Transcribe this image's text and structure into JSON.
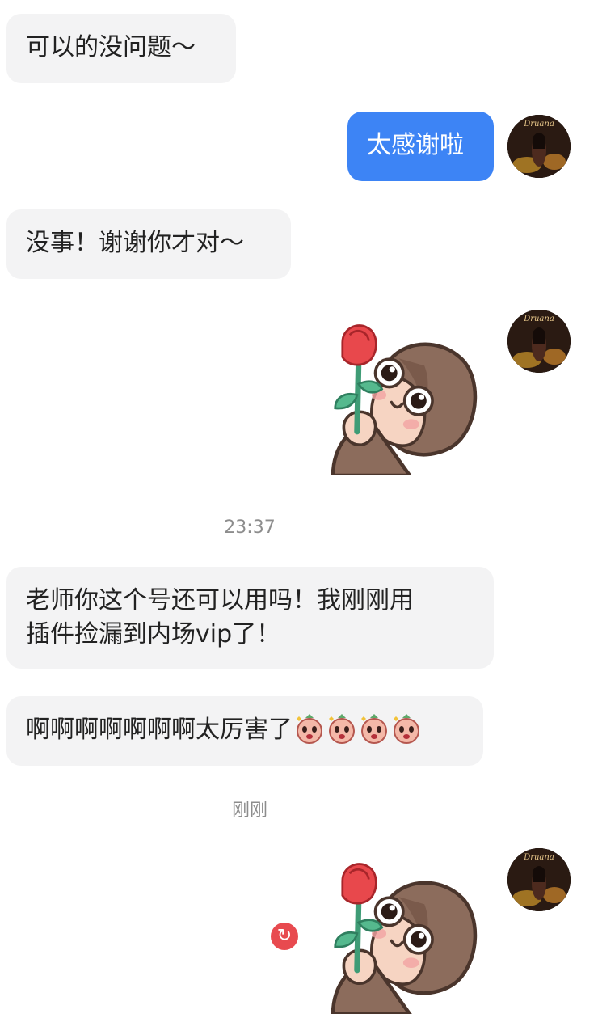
{
  "messages": {
    "m1": "可以的没问题～",
    "m2": "太感谢啦",
    "m3": "没事！谢谢你才对～",
    "m5_line1": "老师你这个号还可以用吗！我刚刚用",
    "m5_line2": "插件捡漏到内场vip了！",
    "m6": "啊啊啊啊啊啊啊太厉害了"
  },
  "timestamps": {
    "t1": "23:37",
    "t2": "刚刚"
  },
  "avatar": {
    "label": "Druana"
  },
  "retry_icon": "↻",
  "colors": {
    "incoming_bubble": "#f3f3f4",
    "outgoing_bubble": "#3d84f5",
    "retry": "#e84a4f"
  }
}
